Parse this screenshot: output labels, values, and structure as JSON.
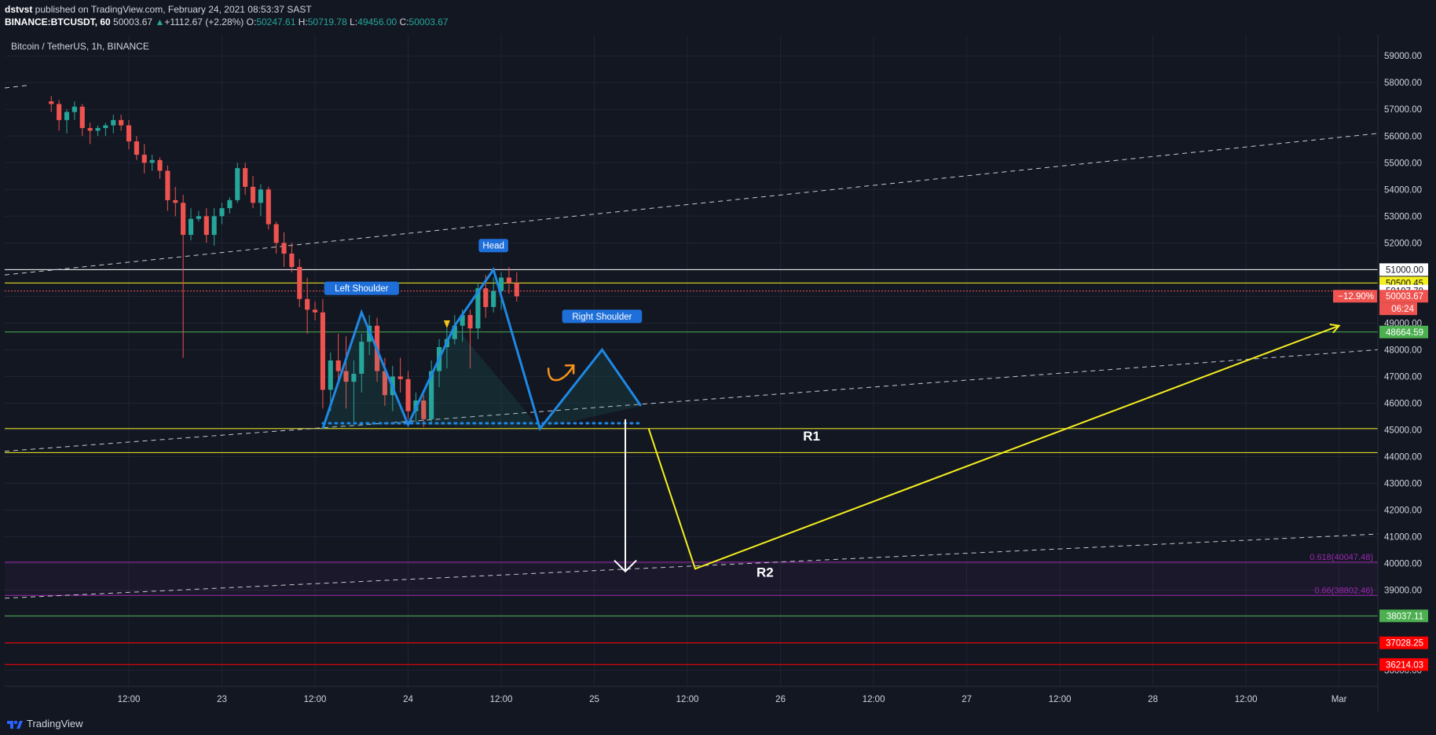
{
  "header": {
    "user": "dstvst",
    "published": " published on TradingView.com, February 24, 2021 08:53:37 SAST",
    "symbol": "BINANCE:BTCUSDT, 60",
    "price": "50003.67",
    "change": "+1112.67 (+2.28%)",
    "o_label": "O:",
    "o_value": "50247.61",
    "h_label": "H:",
    "h_value": "50719.78",
    "l_label": "L:",
    "l_value": "49456.00",
    "c_label": "C:",
    "c_value": "50003.67"
  },
  "footer": {
    "brand": "TradingView",
    "icon": "tradingview-logo-icon"
  },
  "colors": {
    "background": "#131722",
    "up": "#26a69a",
    "down": "#ef5350",
    "pattern": "#1e88e5",
    "yellow": "#f5ef1f",
    "white": "#ffffff",
    "green_line": "#4caf50",
    "red_line": "#ff0000",
    "purple": "#9c27b0",
    "grid": "#1f2433",
    "badge_blue": "#1e6fd9"
  },
  "chart_data": {
    "type": "candlestick",
    "title": "Bitcoin / TetherUS, 1h, BINANCE",
    "ylim": [
      35400,
      59800
    ],
    "y_ticks": [
      59000,
      58000,
      57000,
      56000,
      55000,
      54000,
      53000,
      52000,
      51000,
      50000,
      49000,
      48000,
      47000,
      46000,
      45000,
      44000,
      43000,
      42000,
      41000,
      40000,
      39000,
      38000,
      37000,
      36000
    ],
    "y_tick_labels": [
      "59000.00",
      "58000.00",
      "57000.00",
      "56000.00",
      "55000.00",
      "54000.00",
      "53000.00",
      "52000.00",
      "51000.00",
      "50000.00",
      "49000.00",
      "48000.00",
      "47000.00",
      "46000.00",
      "45000.00",
      "44000.00",
      "43000.00",
      "42000.00",
      "41000.00",
      "40000.00",
      "39000.00",
      "38000.00",
      "37000.00",
      "36000.00"
    ],
    "x_ticks": [
      {
        "t": 36,
        "label": "12:00"
      },
      {
        "t": 48,
        "label": "23"
      },
      {
        "t": 60,
        "label": "12:00"
      },
      {
        "t": 72,
        "label": "24"
      },
      {
        "t": 84,
        "label": "12:00"
      },
      {
        "t": 96,
        "label": "25"
      },
      {
        "t": 108,
        "label": "12:00"
      },
      {
        "t": 120,
        "label": "26"
      },
      {
        "t": 132,
        "label": "12:00"
      },
      {
        "t": 144,
        "label": "27"
      },
      {
        "t": 156,
        "label": "12:00"
      },
      {
        "t": 168,
        "label": "28"
      },
      {
        "t": 180,
        "label": "12:00"
      },
      {
        "t": 192,
        "label": "Mar"
      }
    ],
    "candles": [
      [
        26.0,
        57300,
        57500,
        56900,
        57200
      ],
      [
        27.0,
        57200,
        57350,
        56200,
        56600
      ],
      [
        28.0,
        56600,
        57000,
        56100,
        56900
      ],
      [
        29.0,
        56900,
        57300,
        56600,
        57100
      ],
      [
        30.0,
        57100,
        57200,
        56000,
        56300
      ],
      [
        31.0,
        56300,
        56500,
        55700,
        56200
      ],
      [
        32.0,
        56200,
        56400,
        56000,
        56300
      ],
      [
        33.0,
        56300,
        56500,
        56000,
        56400
      ],
      [
        34.0,
        56400,
        56800,
        56100,
        56600
      ],
      [
        35.0,
        56600,
        56800,
        56200,
        56400
      ],
      [
        36.0,
        56400,
        56600,
        55500,
        55800
      ],
      [
        37.0,
        55800,
        56000,
        55100,
        55300
      ],
      [
        38.0,
        55300,
        55700,
        54600,
        55000
      ],
      [
        39.0,
        55000,
        55300,
        54700,
        55100
      ],
      [
        40.0,
        55100,
        55200,
        54400,
        54700
      ],
      [
        41.0,
        54700,
        54900,
        53200,
        53600
      ],
      [
        42.0,
        53600,
        54100,
        53000,
        53500
      ],
      [
        43.0,
        53500,
        53800,
        47700,
        52300
      ],
      [
        44.0,
        52300,
        53300,
        52100,
        52900
      ],
      [
        45.0,
        52900,
        53200,
        52800,
        53000
      ],
      [
        46.0,
        53000,
        53300,
        52000,
        52300
      ],
      [
        47.0,
        52300,
        53300,
        51900,
        53000
      ],
      [
        48.0,
        53000,
        53500,
        52700,
        53300
      ],
      [
        49.0,
        53300,
        53700,
        53100,
        53600
      ],
      [
        50.0,
        53600,
        55000,
        53500,
        54800
      ],
      [
        51.0,
        54800,
        55000,
        53800,
        54100
      ],
      [
        52.0,
        54100,
        54500,
        53300,
        53500
      ],
      [
        53.0,
        53500,
        54200,
        53000,
        54000
      ],
      [
        54.0,
        54000,
        54100,
        52500,
        52700
      ],
      [
        55.0,
        52700,
        52800,
        51600,
        52000
      ],
      [
        56.0,
        52000,
        52400,
        51100,
        51600
      ],
      [
        57.0,
        51600,
        52000,
        50900,
        51100
      ],
      [
        58.0,
        51100,
        51400,
        49600,
        49900
      ],
      [
        59.0,
        49900,
        50700,
        48600,
        49500
      ],
      [
        60.0,
        49500,
        49800,
        49100,
        49400
      ],
      [
        61.0,
        49400,
        49900,
        45800,
        46500
      ],
      [
        62.0,
        46500,
        47900,
        45700,
        47600
      ],
      [
        63.0,
        47600,
        48600,
        46800,
        47200
      ],
      [
        64.0,
        47200,
        48500,
        45800,
        46800
      ],
      [
        65.0,
        46800,
        47600,
        45300,
        47100
      ],
      [
        66.0,
        47100,
        48600,
        46400,
        48300
      ],
      [
        67.0,
        48300,
        49300,
        47800,
        48900
      ],
      [
        68.0,
        48900,
        49200,
        46800,
        47200
      ],
      [
        69.0,
        47200,
        47700,
        45900,
        46300
      ],
      [
        70.0,
        46300,
        47400,
        45700,
        47000
      ],
      [
        71.0,
        47000,
        47700,
        46400,
        46900
      ],
      [
        72.0,
        46900,
        47200,
        45400,
        45700
      ],
      [
        73.0,
        45700,
        46400,
        45300,
        46100
      ],
      [
        74.0,
        46100,
        46300,
        45100,
        45400
      ],
      [
        75.0,
        45400,
        47600,
        45200,
        47200
      ],
      [
        76.0,
        47200,
        48400,
        46600,
        48100
      ],
      [
        77.0,
        48100,
        48800,
        47300,
        48400
      ],
      [
        78.0,
        48400,
        49300,
        48200,
        48900
      ],
      [
        79.0,
        48900,
        49500,
        48300,
        49300
      ],
      [
        80.0,
        49300,
        49500,
        47300,
        48800
      ],
      [
        81.0,
        48800,
        50500,
        48400,
        50300
      ],
      [
        82.0,
        50300,
        50800,
        49200,
        49600
      ],
      [
        83.0,
        49600,
        50700,
        49400,
        50200
      ],
      [
        84.0,
        50200,
        50900,
        49500,
        50700
      ],
      [
        85.0,
        50700,
        51100,
        50100,
        50500
      ],
      [
        86.0,
        50500,
        50900,
        49800,
        50000
      ]
    ],
    "series": [
      {
        "type": "dashed-trend",
        "points": [
          [
            20,
            50800
          ],
          [
            197,
            56100
          ]
        ]
      },
      {
        "type": "dashed-trend",
        "points": [
          [
            20,
            44200
          ],
          [
            197,
            48000
          ]
        ]
      },
      {
        "type": "dashed-trend",
        "points": [
          [
            20,
            38700
          ],
          [
            197,
            41100
          ]
        ]
      },
      {
        "type": "dashed-stub",
        "points": [
          [
            20,
            57800
          ],
          [
            23,
            57900
          ]
        ]
      }
    ],
    "levels": [
      {
        "name": "white",
        "y": 51000,
        "color": "#ffffff",
        "label": "51000.00",
        "label_bg": "#ffffff",
        "label_fg": "#131722"
      },
      {
        "name": "yellow-top",
        "y": 50500.45,
        "color": "#f5ef1f",
        "label": "50500.45",
        "label_bg": "#f5ef1f",
        "label_fg": "#131722"
      },
      {
        "name": "price",
        "y": 50197.79,
        "color": "#b0b3c0",
        "label": "50197.79",
        "label_bg": "#ffffff",
        "label_fg": "#131722"
      },
      {
        "name": "green-top",
        "y": 48664.59,
        "color": "#4caf50",
        "label": "48664.59",
        "label_bg": "#4caf50",
        "label_fg": "#ffffff"
      },
      {
        "name": "yellow-mid",
        "y": 45050,
        "color": "#f5ef1f",
        "label": "",
        "label_bg": "",
        "label_fg": ""
      },
      {
        "name": "yellow-low",
        "y": 44150,
        "color": "#f5ef1f",
        "label": "",
        "label_bg": "",
        "label_fg": ""
      },
      {
        "name": "purple-top",
        "y": 40047.48,
        "color": "#9c27b0",
        "label": "",
        "label_bg": "",
        "label_fg": ""
      },
      {
        "name": "purple-low",
        "y": 38802.46,
        "color": "#9c27b0",
        "label": "",
        "label_bg": "",
        "label_fg": ""
      },
      {
        "name": "green-low",
        "y": 38037.11,
        "color": "#4caf50",
        "label": "38037.11",
        "label_bg": "#4caf50",
        "label_fg": "#ffffff"
      },
      {
        "name": "red-1",
        "y": 37028.25,
        "color": "#ff0000",
        "label": "37028.25",
        "label_bg": "#ff0000",
        "label_fg": "#ffffff"
      },
      {
        "name": "red-2",
        "y": 36214.03,
        "color": "#ff0000",
        "label": "36214.03",
        "label_bg": "#ff0000",
        "label_fg": "#ffffff"
      }
    ],
    "last_price": {
      "label": "50003.67",
      "value": 50003.67,
      "countdown": "06:24",
      "pct": "−12.90%"
    },
    "fib_labels": [
      {
        "text": "0.618(40047.48)",
        "y": 40047.48
      },
      {
        "text": "0.66(38802.46)",
        "y": 38802.46
      }
    ],
    "pattern": {
      "points": [
        [
          61,
          45050
        ],
        [
          66,
          49400
        ],
        [
          72,
          45200
        ],
        [
          78,
          48900
        ],
        [
          83,
          51000
        ],
        [
          89,
          45050
        ],
        [
          97,
          48000
        ],
        [
          102,
          45900
        ]
      ],
      "neckline": [
        [
          61,
          45250
        ],
        [
          102,
          45250
        ]
      ],
      "labels": [
        {
          "text": "Left Shoulder",
          "at": [
            66,
            50300
          ]
        },
        {
          "text": "Head",
          "at": [
            83,
            51900
          ]
        },
        {
          "text": "Right Shoulder",
          "at": [
            97,
            49250
          ]
        }
      ]
    },
    "projection": {
      "yellow_path": [
        [
          103,
          45050
        ],
        [
          109,
          39800
        ],
        [
          192,
          48900
        ]
      ],
      "white_arrow": [
        [
          100,
          45400
        ],
        [
          100,
          39700
        ]
      ]
    },
    "text_labels": [
      {
        "text": "R1",
        "at": [
          124,
          44600
        ]
      },
      {
        "text": "R2",
        "at": [
          118,
          39500
        ]
      }
    ]
  }
}
